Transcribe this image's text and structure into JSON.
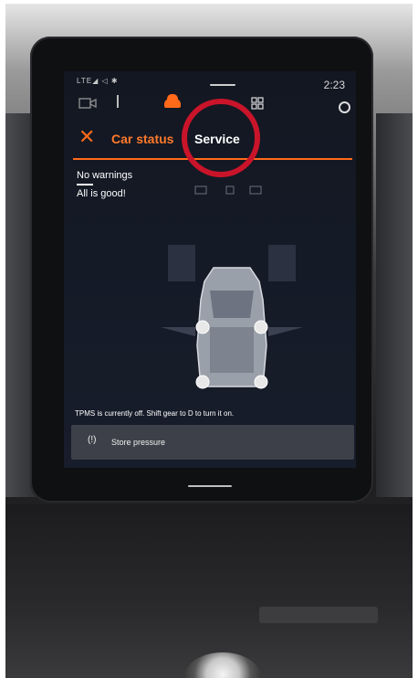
{
  "status_bar": {
    "signal_text": "LTE◢ ◁ ✱",
    "time": "2:23"
  },
  "top_icons": {
    "camera_icon": "camera-icon",
    "car_icon": "car-icon",
    "apps_icon": "apps-grid-icon",
    "ring_icon": "circle-icon"
  },
  "header": {
    "close_label": "✕",
    "car_status_label": "Car status",
    "service_label": "Service"
  },
  "status": {
    "warnings": "No warnings",
    "summary": "All is good!"
  },
  "tpms": {
    "message": "TPMS is currently off. Shift gear to D to turn it on.",
    "store_icon": "(!)",
    "store_label": "Store pressure"
  },
  "colors": {
    "accent": "#ff6a1a",
    "highlight": "#c9142a",
    "screen_bg": "#141a26"
  }
}
